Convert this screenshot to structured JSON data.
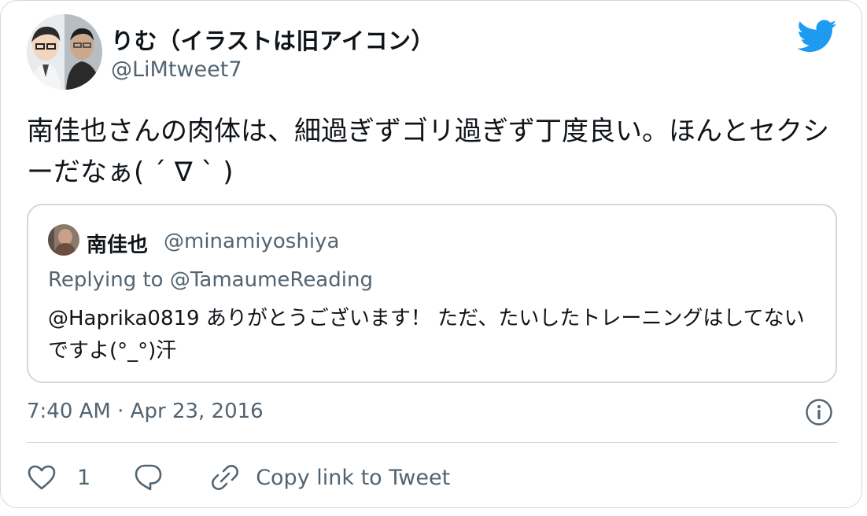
{
  "author": {
    "display_name": "りむ（イラストは旧アイコン）",
    "handle": "@LiMtweet7"
  },
  "tweet": {
    "text": "南佳也さんの肉体は、細過ぎずゴリ過ぎず丁度良い。ほんとセクシーだなぁ( ´ ∇ ` )"
  },
  "quoted_tweet": {
    "name": "南佳也",
    "handle": "@minamiyoshiya",
    "replying_to": "Replying to @TamaumeReading",
    "text": "@Haprika0819 ありがとうございます！ ただ、たいしたトレーニングはしてないですよ(°_°)汗"
  },
  "meta": {
    "timestamp": "7:40 AM · Apr 23, 2016"
  },
  "actions": {
    "like_count": "1",
    "copy_link_label": "Copy link to Tweet"
  },
  "icons": {
    "brand": "twitter-bird-icon",
    "info": "info-icon",
    "like": "heart-icon",
    "reply": "speech-bubble-icon",
    "copy": "link-icon"
  },
  "colors": {
    "brand": "#1d9bf0",
    "secondary_text": "#536471",
    "border": "#cfd9de"
  }
}
